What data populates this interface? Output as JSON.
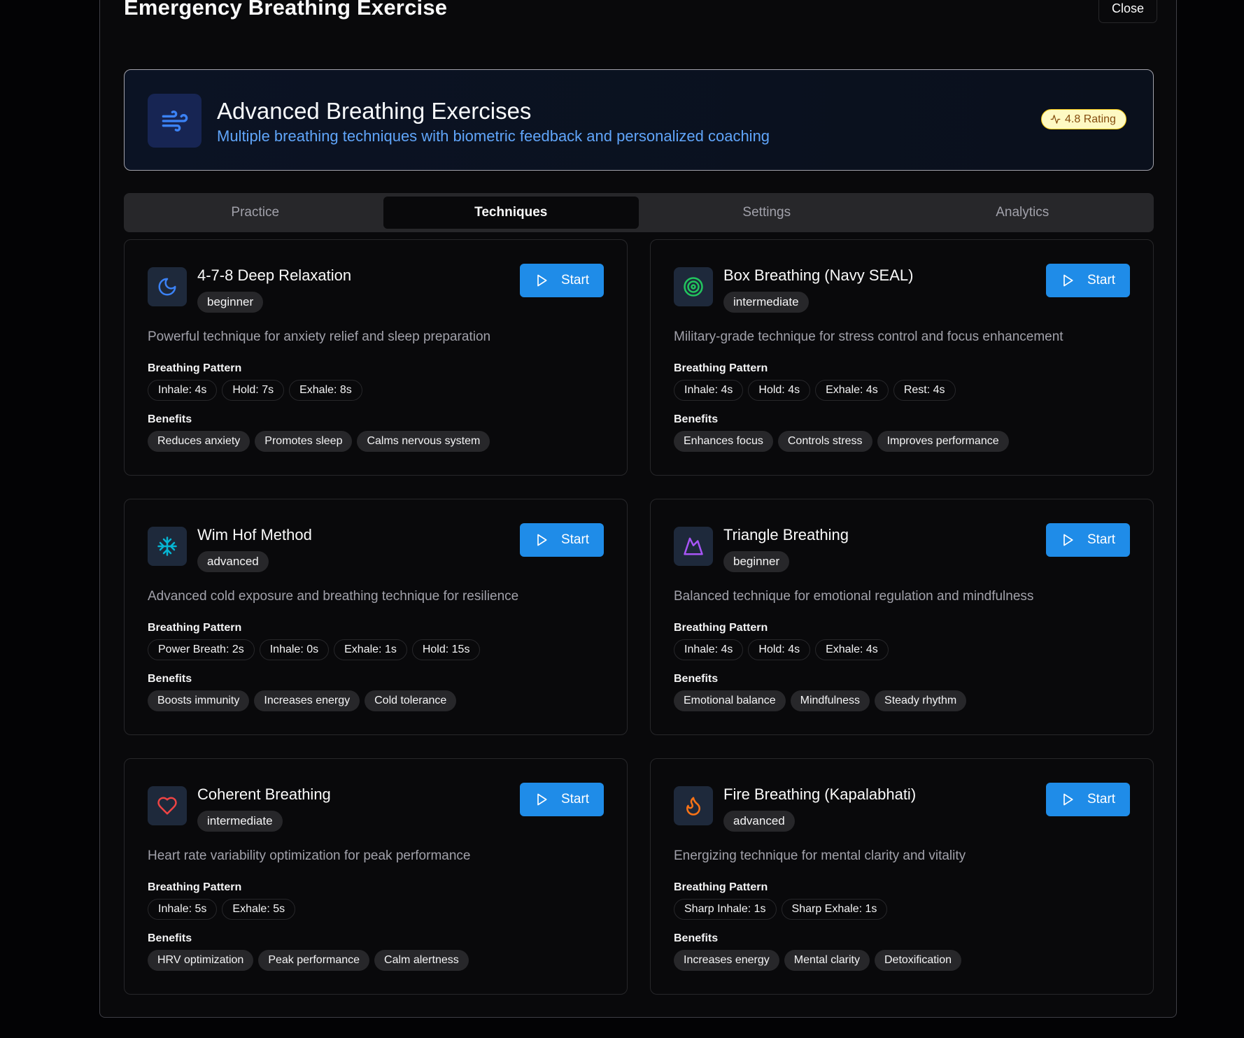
{
  "dialog": {
    "title": "Emergency Breathing Exercise",
    "close_label": "Close"
  },
  "hero": {
    "icon": "wind-icon",
    "title": "Advanced Breathing Exercises",
    "subtitle": "Multiple breathing techniques with biometric feedback and personalized coaching",
    "rating_label": "4.8 Rating"
  },
  "tabs": [
    {
      "label": "Practice",
      "active": false
    },
    {
      "label": "Techniques",
      "active": true
    },
    {
      "label": "Settings",
      "active": false
    },
    {
      "label": "Analytics",
      "active": false
    }
  ],
  "labels": {
    "pattern": "Breathing Pattern",
    "benefits": "Benefits",
    "start": "Start"
  },
  "techniques": [
    {
      "icon": "moon-icon",
      "icon_color": "#3b82f6",
      "title": "4-7-8 Deep Relaxation",
      "level": "beginner",
      "description": "Powerful technique for anxiety relief and sleep preparation",
      "pattern": [
        "Inhale: 4s",
        "Hold: 7s",
        "Exhale: 8s"
      ],
      "benefits": [
        "Reduces anxiety",
        "Promotes sleep",
        "Calms nervous system"
      ]
    },
    {
      "icon": "target-icon",
      "icon_color": "#22c55e",
      "title": "Box Breathing (Navy SEAL)",
      "level": "intermediate",
      "description": "Military-grade technique for stress control and focus enhancement",
      "pattern": [
        "Inhale: 4s",
        "Hold: 4s",
        "Exhale: 4s",
        "Rest: 4s"
      ],
      "benefits": [
        "Enhances focus",
        "Controls stress",
        "Improves performance"
      ]
    },
    {
      "icon": "snowflake-icon",
      "icon_color": "#06b6d4",
      "title": "Wim Hof Method",
      "level": "advanced",
      "description": "Advanced cold exposure and breathing technique for resilience",
      "pattern": [
        "Power Breath: 2s",
        "Inhale: 0s",
        "Exhale: 1s",
        "Hold: 15s"
      ],
      "benefits": [
        "Boosts immunity",
        "Increases energy",
        "Cold tolerance"
      ]
    },
    {
      "icon": "mountain-icon",
      "icon_color": "#a855f7",
      "title": "Triangle Breathing",
      "level": "beginner",
      "description": "Balanced technique for emotional regulation and mindfulness",
      "pattern": [
        "Inhale: 4s",
        "Hold: 4s",
        "Exhale: 4s"
      ],
      "benefits": [
        "Emotional balance",
        "Mindfulness",
        "Steady rhythm"
      ]
    },
    {
      "icon": "heart-icon",
      "icon_color": "#ef4444",
      "title": "Coherent Breathing",
      "level": "intermediate",
      "description": "Heart rate variability optimization for peak performance",
      "pattern": [
        "Inhale: 5s",
        "Exhale: 5s"
      ],
      "benefits": [
        "HRV optimization",
        "Peak performance",
        "Calm alertness"
      ]
    },
    {
      "icon": "flame-icon",
      "icon_color": "#f97316",
      "title": "Fire Breathing (Kapalabhati)",
      "level": "advanced",
      "description": "Energizing technique for mental clarity and vitality",
      "pattern": [
        "Sharp Inhale: 1s",
        "Sharp Exhale: 1s"
      ],
      "benefits": [
        "Increases energy",
        "Mental clarity",
        "Detoxification"
      ]
    }
  ]
}
